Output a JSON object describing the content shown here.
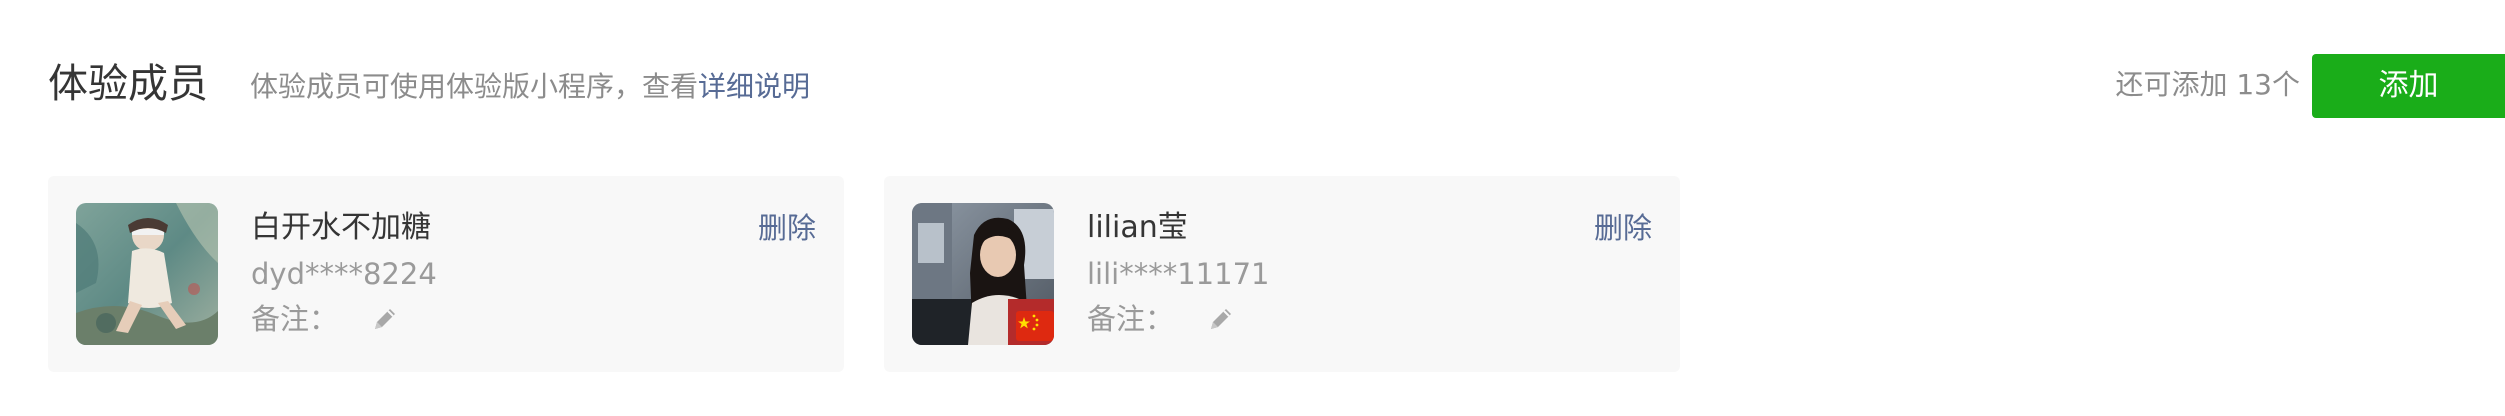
{
  "header": {
    "title": "体验成员",
    "description": "体验成员可使用体验版小程序，查看",
    "help_link": "详细说明",
    "remaining": "还可添加 13个",
    "add_label": "添加"
  },
  "members": [
    {
      "name": "白开水不加糖",
      "account": "dyd****8224",
      "remark_label": "备注：",
      "delete_label": "删除"
    },
    {
      "name": "lilian莹",
      "account": "lili****11171",
      "remark_label": "备注：",
      "delete_label": "删除"
    }
  ],
  "colors": {
    "primary_green": "#1aad19",
    "link_blue": "#576b95",
    "card_bg": "#f8f8f8"
  },
  "icons": {
    "edit": "pencil-icon",
    "flag": "china-flag-icon"
  }
}
